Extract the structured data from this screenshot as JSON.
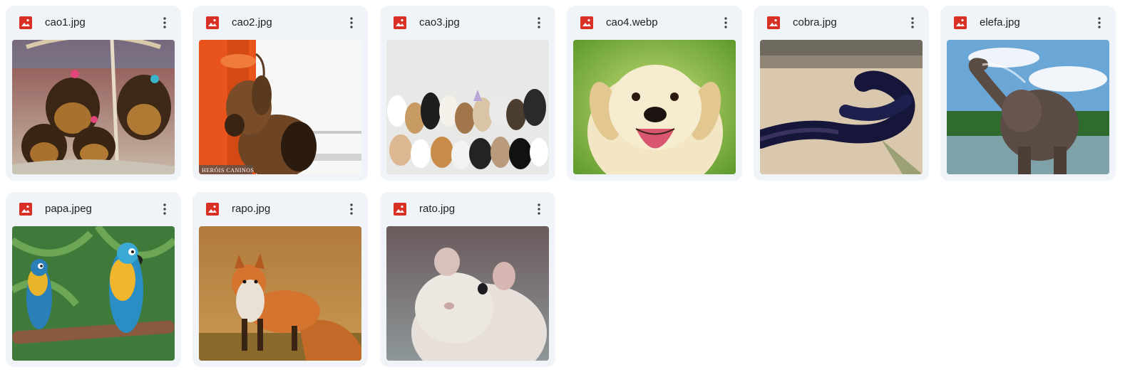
{
  "files": [
    {
      "name": "cao1.jpg",
      "icon": "image-file-icon",
      "thumbnail": "Yorkshire terrier puppies in a basket with bows"
    },
    {
      "name": "cao2.jpg",
      "icon": "image-file-icon",
      "thumbnail": "Bloodhound dog beside handler in orange uniform",
      "watermark": "HERÓIS CANINOS"
    },
    {
      "name": "cao3.jpg",
      "icon": "image-file-icon",
      "thumbnail": "Large group of assorted dogs against a white wall"
    },
    {
      "name": "cao4.webp",
      "icon": "image-file-icon",
      "thumbnail": "Smiling yellow Labrador puppy on green background"
    },
    {
      "name": "cobra.jpg",
      "icon": "image-file-icon",
      "thumbnail": "Large dark snake on sandy ground"
    },
    {
      "name": "elefa.jpg",
      "icon": "image-file-icon",
      "thumbnail": "Elephant spraying water in a river"
    },
    {
      "name": "papa.jpeg",
      "icon": "image-file-icon",
      "thumbnail": "Two blue-and-yellow macaws on a branch"
    },
    {
      "name": "rapo.jpg",
      "icon": "image-file-icon",
      "thumbnail": "Red fox standing in golden grass"
    },
    {
      "name": "rato.jpg",
      "icon": "image-file-icon",
      "thumbnail": "White mouse close-up"
    }
  ],
  "more_actions_icon": "more-vertical-icon",
  "colors": {
    "card_background": "#f0f4f9",
    "image_icon_red": "#d93025",
    "text": "#1f1f1f"
  }
}
